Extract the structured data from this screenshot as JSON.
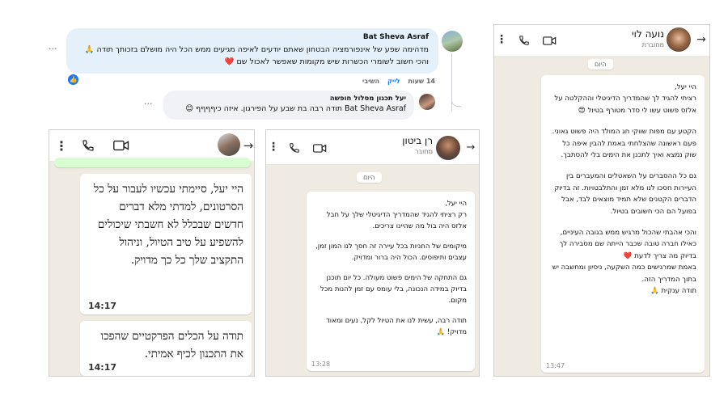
{
  "fb": {
    "comment": {
      "author": "Bat Sheva Asraf",
      "text": "מדהימה שפע של אינפורמציה הבטחון שאתם יודעים לאיפה מגיעים ממש הכל היה מושלם בזכותך תודה 🙏 והכי חשוב לשומרי הכשרות שיש מקומות שאפשר לאכול שם ❤️",
      "time": "14 שעות",
      "like": "לייק",
      "reply": "השיבי",
      "more": "···"
    },
    "reply": {
      "author": "יעל תכנון מסלול חופשה",
      "text": "Bat Sheva Asraf תודה רבה בת שבע על הפירגון. איזה כיףףףף 😊",
      "more": "···"
    }
  },
  "chat_left": {
    "date_fragment": "",
    "bubble1": {
      "text": "היי יעל, סיימתי עכשיו לעבור על כל הסרטונים, למדתי מלא דברים חדשים שבכלל לא חשבתי שיכולים להשפיע על טיב הטיול, וניהול התקציב שלך כל כך מדויק.",
      "time": "14:17"
    },
    "bubble2": {
      "text": "תודה על הכלים הפרקטיים שהפכו את התכנון לכיף אמיתי.",
      "time": "14:17"
    }
  },
  "chat_middle": {
    "name": "רן ביטון",
    "status": "מחובר",
    "date": "היום",
    "paragraphs": [
      "היי יעל,\nרק רציתי להגיד שהמדריך הדיגיטלי שלך על חבל אלזס היה בול מה שהיינו צריכים.",
      "מיקומים של החניות בכל עיירה זה חסך לנו המון זמן, עצבים ותיפוסים. הכול היה ברור ומדויק.",
      "גם התחקה של הימים  פשוט מעולה. כל יום תוכנן בדיוק במידה הנכונה, בלי עומס עם זמן להנות מכל מקום.",
      "תודה רבה, עשית לנו את הטיול לקל, נעים ומאוד מדויק! 🙏"
    ],
    "time": "13:28"
  },
  "chat_right": {
    "name": "נועה לוי",
    "status": "מחוברת",
    "date": "היום",
    "paragraphs": [
      "היי יעל,\nרציתי להגיד לך שהמדריך הדיגיטלי וההקלטה על אלזס פשוט עשו לי סדר מטורף בטיול 😍",
      "הקטע עם מפות שווקי חג המולד היה פשוט גאוני. פעם ראשונה שהצלחתי באמת להבין איפה כל שוק נמצא ואיך לתכנן את הימים בלי להסתבך.",
      "גם כל ההסברים על השאטלים והמעברים בין העיירות חסכו לנו מלא זמן והתלבטויות. זה בדיוק הדברים הקטנים שלא תמיד מוצאים לבד, אבל בפועל הם הכי חשובים בטיול.",
      "והכי אהבתי שהכול מרגיש ממש בגובה העיניים, כאילו חברה טובה שכבר הייתה שם מסבירה לך בדיוק מה צריך לדעת ❤️\nבאמת שמרגישים כמה השקעה, ניסיון ומחשבה יש בתוך המדריך הזה.\nתודה ענקית 🙏"
    ],
    "time": "13:47"
  },
  "colors": {
    "wa_bg": "#efeae2",
    "fb_bubble": "#e4f1fb",
    "fb_like_blue": "#1877f2",
    "heart": "#e02020"
  }
}
